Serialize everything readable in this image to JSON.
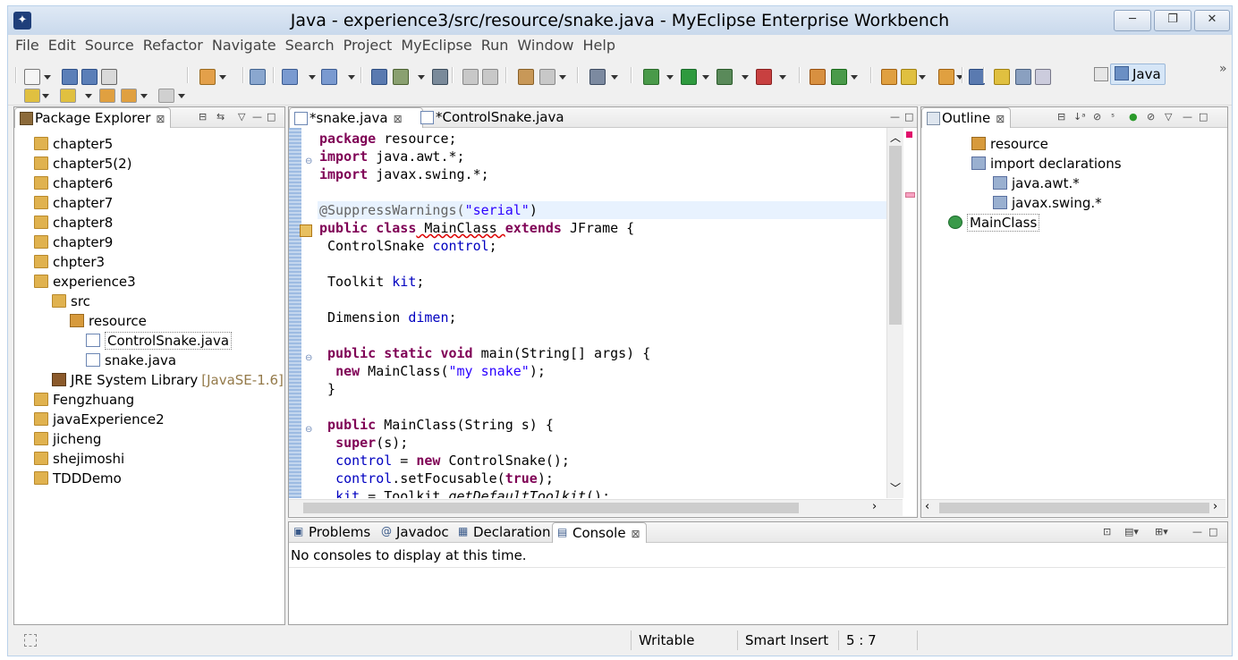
{
  "window": {
    "title": "Java - experience3/src/resource/snake.java - MyEclipse Enterprise Workbench",
    "minimize": "─",
    "maximize": "❐",
    "close": "✕"
  },
  "menu": [
    "File",
    "Edit",
    "Source",
    "Refactor",
    "Navigate",
    "Search",
    "Project",
    "MyEclipse",
    "Run",
    "Window",
    "Help"
  ],
  "perspective": {
    "label": "Java",
    "chevron": "»"
  },
  "package_explorer": {
    "tab_label": "Package Explorer",
    "items": [
      {
        "label": "chapter5"
      },
      {
        "label": "chapter5(2)"
      },
      {
        "label": "chapter6"
      },
      {
        "label": "chapter7"
      },
      {
        "label": "chapter8"
      },
      {
        "label": "chapter9"
      },
      {
        "label": "chpter3"
      },
      {
        "label": "experience3"
      },
      {
        "label": "src"
      },
      {
        "label": "resource"
      },
      {
        "label": "ControlSnake.java"
      },
      {
        "label": "snake.java"
      },
      {
        "label": "JRE System Library",
        "suffix": "[JavaSE-1.6]"
      },
      {
        "label": "Fengzhuang"
      },
      {
        "label": "javaExperience2"
      },
      {
        "label": "jicheng"
      },
      {
        "label": "shejimoshi"
      },
      {
        "label": "TDDDemo"
      }
    ]
  },
  "editor": {
    "tabs": [
      "*snake.java",
      "*ControlSnake.java"
    ],
    "lines": [
      [
        {
          "t": "package",
          "k": "kw"
        },
        {
          "t": " resource;"
        }
      ],
      [
        {
          "t": "import",
          "k": "kw"
        },
        {
          "t": " java.awt.*;"
        }
      ],
      [
        {
          "t": "import",
          "k": "kw"
        },
        {
          "t": " javax.swing.*;"
        }
      ],
      [],
      [
        {
          "t": "@SuppressWarnings(",
          "k": "ann"
        },
        {
          "t": "\"serial\"",
          "k": "str"
        },
        {
          "t": ")"
        }
      ],
      [
        {
          "t": "public",
          "k": "kw"
        },
        {
          "t": " "
        },
        {
          "t": "class",
          "k": "kw"
        },
        {
          "t": " MainClass "
        },
        {
          "t": "extends",
          "k": "kw"
        },
        {
          "t": " JFrame {"
        }
      ],
      [
        {
          "t": " ControlSnake "
        },
        {
          "t": "control",
          "k": "fld"
        },
        {
          "t": ";"
        }
      ],
      [],
      [
        {
          "t": " Toolkit "
        },
        {
          "t": "kit",
          "k": "fld"
        },
        {
          "t": ";"
        }
      ],
      [],
      [
        {
          "t": " Dimension "
        },
        {
          "t": "dimen",
          "k": "fld"
        },
        {
          "t": ";"
        }
      ],
      [],
      [
        {
          "t": " "
        },
        {
          "t": "public",
          "k": "kw"
        },
        {
          "t": " "
        },
        {
          "t": "static",
          "k": "kw"
        },
        {
          "t": " "
        },
        {
          "t": "void",
          "k": "kw"
        },
        {
          "t": " main(String[] args) {"
        }
      ],
      [
        {
          "t": "  "
        },
        {
          "t": "new",
          "k": "kw"
        },
        {
          "t": " MainClass("
        },
        {
          "t": "\"my snake\"",
          "k": "str"
        },
        {
          "t": ");"
        }
      ],
      [
        {
          "t": " }"
        }
      ],
      [],
      [
        {
          "t": " "
        },
        {
          "t": "public",
          "k": "kw"
        },
        {
          "t": " MainClass(String s) {"
        }
      ],
      [
        {
          "t": "  "
        },
        {
          "t": "super",
          "k": "kw"
        },
        {
          "t": "(s);"
        }
      ],
      [
        {
          "t": "  "
        },
        {
          "t": "control",
          "k": "fld"
        },
        {
          "t": " = "
        },
        {
          "t": "new",
          "k": "kw"
        },
        {
          "t": " ControlSnake();"
        }
      ],
      [
        {
          "t": "  "
        },
        {
          "t": "control",
          "k": "fld"
        },
        {
          "t": ".setFocusable("
        },
        {
          "t": "true",
          "k": "kw"
        },
        {
          "t": ");"
        }
      ],
      [
        {
          "t": "  "
        },
        {
          "t": "kit",
          "k": "fld"
        },
        {
          "t": " = Toolkit."
        },
        {
          "t": "getDefaultToolkit",
          "k": "ital"
        },
        {
          "t": "();"
        }
      ]
    ]
  },
  "outline": {
    "tab_label": "Outline",
    "items": [
      "resource",
      "import declarations",
      "java.awt.*",
      "javax.swing.*",
      "MainClass"
    ]
  },
  "bottom": {
    "tabs": [
      "Problems",
      "Javadoc",
      "Declaration",
      "Console"
    ],
    "message": "No consoles to display at this time."
  },
  "status": {
    "writable": "Writable",
    "insert_mode": "Smart Insert",
    "position": "5 : 7"
  },
  "colors": {
    "keyword": "#7f0055",
    "field": "#0000c0",
    "string": "#2a00ff",
    "accent": "#b9d1ea"
  }
}
